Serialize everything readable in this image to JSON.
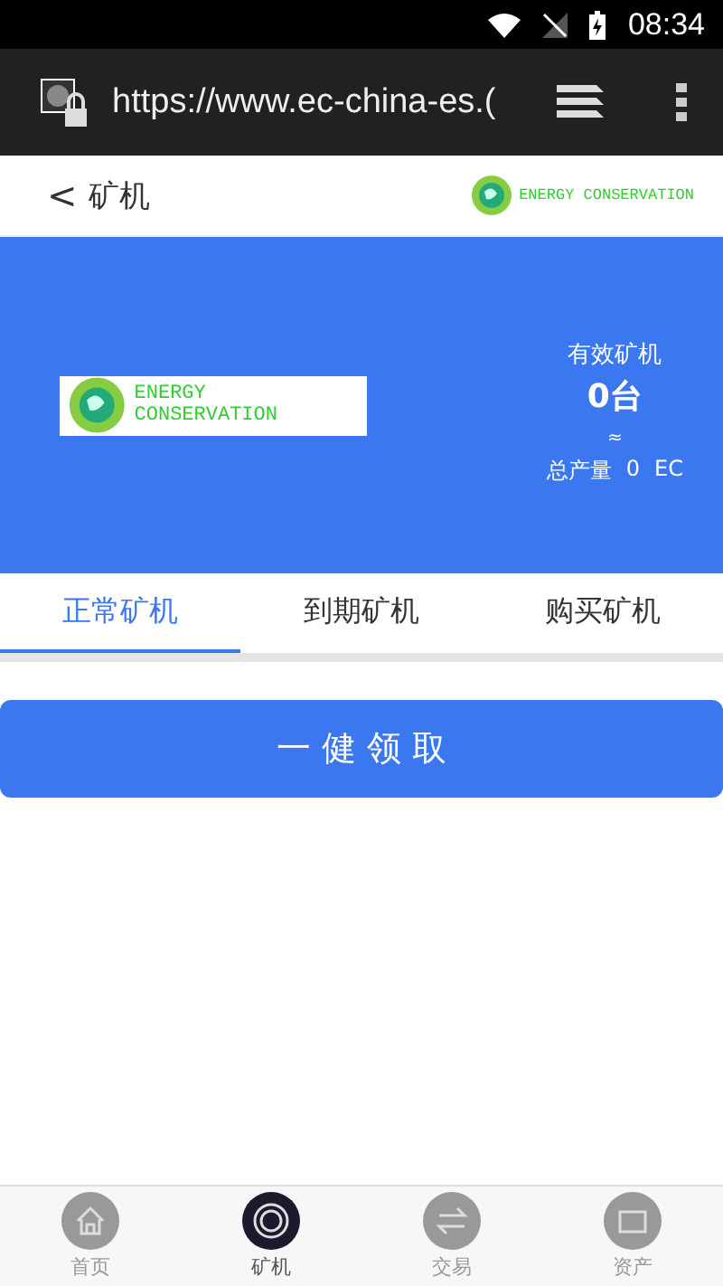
{
  "status_bar": {
    "time": "08:34"
  },
  "browser": {
    "url": "https://www.ec-china-es.("
  },
  "header": {
    "back": "<",
    "title": "矿机",
    "logo_text": "ENERGY CONSERVATION"
  },
  "banner": {
    "logo_text": "ENERGY CONSERVATION",
    "label": "有效矿机",
    "count": "0台",
    "approx": "≈",
    "total_label": "总产量",
    "total_value": "0",
    "total_unit": "EC"
  },
  "tabs": [
    {
      "label": "正常矿机",
      "selected": true
    },
    {
      "label": "到期矿机",
      "selected": false
    },
    {
      "label": "购买矿机",
      "selected": false
    }
  ],
  "action_button": "一 健 领 取",
  "bottom_nav": [
    {
      "label": "首页",
      "kind": "home",
      "selected": false
    },
    {
      "label": "矿机",
      "kind": "miner",
      "selected": true
    },
    {
      "label": "交易",
      "kind": "trade",
      "selected": false
    },
    {
      "label": "资产",
      "kind": "assets",
      "selected": false
    }
  ]
}
